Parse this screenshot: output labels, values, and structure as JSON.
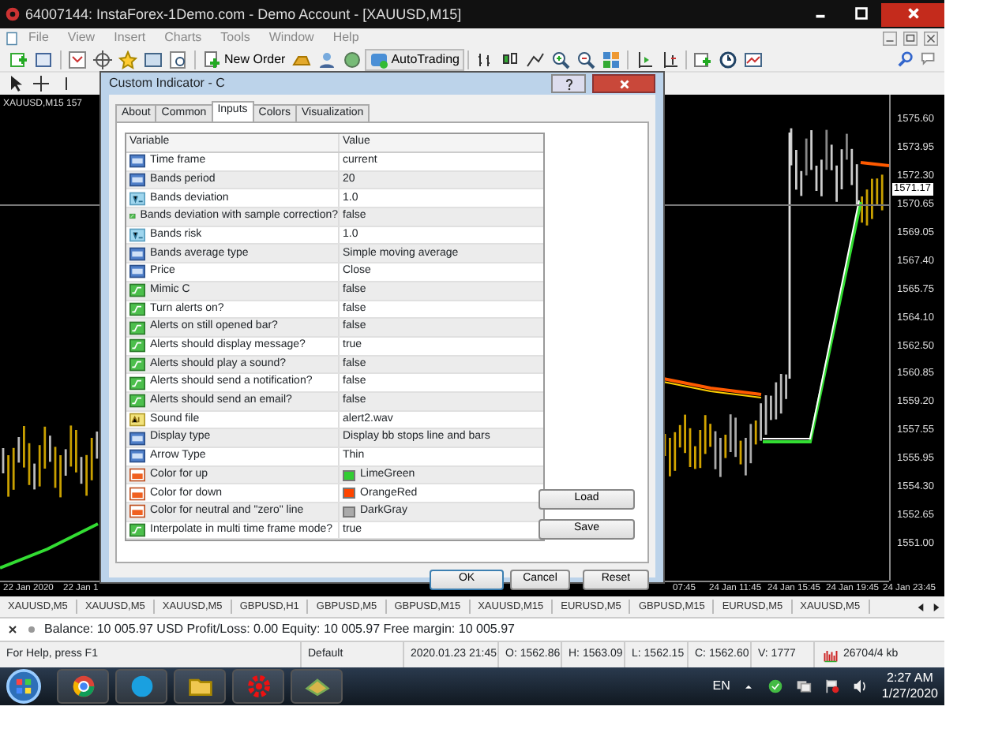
{
  "window": {
    "title": "64007144: InstaForex-1Demo.com - Demo Account - [XAUUSD,M15]"
  },
  "menu": [
    "File",
    "View",
    "Insert",
    "Charts",
    "Tools",
    "Window",
    "Help"
  ],
  "toolbar": {
    "new_order": "New Order",
    "auto_trading": "AutoTrading"
  },
  "chart": {
    "symbol_label": "XAUUSD,M15 157",
    "price_ticks": [
      "1575.60",
      "1573.95",
      "1572.30",
      "1570.65",
      "1569.05",
      "1567.40",
      "1565.75",
      "1564.10",
      "1562.50",
      "1560.85",
      "1559.20",
      "1557.55",
      "1555.95",
      "1554.30",
      "1552.65",
      "1551.00"
    ],
    "current_price": "1571.17",
    "left_time_ticks": [
      "22 Jan 2020",
      "22 Jan 1"
    ],
    "right_time_ticks": [
      "07:45",
      "24 Jan 11:45",
      "24 Jan 15:45",
      "24 Jan 19:45",
      "24 Jan 23:45"
    ]
  },
  "dialog": {
    "title": "Custom Indicator - C",
    "tabs": [
      {
        "label": "About",
        "selected": false
      },
      {
        "label": "Common",
        "selected": false
      },
      {
        "label": "Inputs",
        "selected": true
      },
      {
        "label": "Colors",
        "selected": false
      },
      {
        "label": "Visualization",
        "selected": false
      }
    ],
    "columns": [
      "Variable",
      "Value"
    ],
    "rows": [
      {
        "kind": "int",
        "name": "Time frame",
        "value": "current"
      },
      {
        "kind": "int",
        "name": "Bands period",
        "value": "20"
      },
      {
        "kind": "double",
        "name": "Bands deviation",
        "value": "1.0"
      },
      {
        "kind": "bool",
        "name": "Bands deviation with sample correction?",
        "value": "false"
      },
      {
        "kind": "double",
        "name": "Bands risk",
        "value": "1.0"
      },
      {
        "kind": "int",
        "name": "Bands average type",
        "value": "Simple moving average"
      },
      {
        "kind": "int",
        "name": "Price",
        "value": "Close"
      },
      {
        "kind": "bool",
        "name": "Mimic C",
        "value": "false"
      },
      {
        "kind": "bool",
        "name": "Turn alerts on?",
        "value": "false"
      },
      {
        "kind": "bool",
        "name": "Alerts on still opened bar?",
        "value": "false"
      },
      {
        "kind": "bool",
        "name": "Alerts should display message?",
        "value": "true"
      },
      {
        "kind": "bool",
        "name": "Alerts should play a sound?",
        "value": "false"
      },
      {
        "kind": "bool",
        "name": "Alerts should send a notification?",
        "value": "false"
      },
      {
        "kind": "bool",
        "name": "Alerts should send an email?",
        "value": "false"
      },
      {
        "kind": "string",
        "name": "Sound file",
        "value": "alert2.wav"
      },
      {
        "kind": "int",
        "name": "Display type",
        "value": "Display bb stops line and bars"
      },
      {
        "kind": "int",
        "name": "Arrow Type",
        "value": "Thin"
      },
      {
        "kind": "color",
        "name": "Color for up",
        "value": "LimeGreen",
        "color": "#32cd32"
      },
      {
        "kind": "color",
        "name": "Color for down",
        "value": "OrangeRed",
        "color": "#ff4500"
      },
      {
        "kind": "color",
        "name": "Color for neutral and \"zero\" line",
        "value": "DarkGray",
        "color": "#a9a9a9"
      },
      {
        "kind": "bool",
        "name": "Interpolate in multi time frame mode?",
        "value": "true"
      }
    ],
    "side_buttons": [
      "Load",
      "Save"
    ],
    "buttons": [
      {
        "label": "OK",
        "focused": true
      },
      {
        "label": "Cancel",
        "focused": false
      },
      {
        "label": "Reset",
        "focused": false
      }
    ]
  },
  "symbol_tabs": [
    "XAUUSD,M5",
    "XAUUSD,M5",
    "XAUUSD,M5",
    "GBPUSD,H1",
    "GBPUSD,M5",
    "GBPUSD,M15",
    "XAUUSD,M15",
    "EURUSD,M5",
    "GBPUSD,M15",
    "EURUSD,M5",
    "XAUUSD,M5"
  ],
  "terminal": "Balance: 10 005.97 USD  Profit/Loss: 0.00  Equity: 10 005.97  Free margin: 10 005.97",
  "status_bar": [
    "For Help, press F1",
    "Default",
    "2020.01.23 21:45",
    "O: 1562.86",
    "H: 1563.09",
    "L: 1562.15",
    "C: 1562.60",
    "V: 1777",
    "26704/4 kb"
  ],
  "taskbar": {
    "language": "EN",
    "time": "2:27 AM",
    "date": "1/27/2020"
  }
}
